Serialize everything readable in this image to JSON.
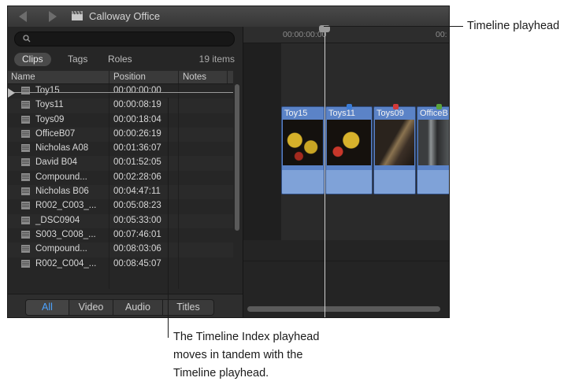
{
  "window": {
    "title": "Calloway Office"
  },
  "search": {
    "placeholder": ""
  },
  "tabs": [
    {
      "label": "Clips",
      "active": true
    },
    {
      "label": "Tags",
      "active": false
    },
    {
      "label": "Roles",
      "active": false
    }
  ],
  "items_count": "19 items",
  "columns": {
    "name": "Name",
    "position": "Position",
    "notes": "Notes"
  },
  "rows": [
    {
      "name": "Toy15",
      "position": "00:00:00:00"
    },
    {
      "name": "Toys11",
      "position": "00:00:08:19"
    },
    {
      "name": "Toys09",
      "position": "00:00:18:04"
    },
    {
      "name": "OfficeB07",
      "position": "00:00:26:19"
    },
    {
      "name": "Nicholas A08",
      "position": "00:01:36:07"
    },
    {
      "name": "David B04",
      "position": "00:01:52:05"
    },
    {
      "name": "Compound...",
      "position": "00:02:28:06"
    },
    {
      "name": "Nicholas B06",
      "position": "00:04:47:11"
    },
    {
      "name": "R002_C003_...",
      "position": "00:05:08:23"
    },
    {
      "name": "_DSC0904",
      "position": "00:05:33:00"
    },
    {
      "name": "S003_C008_...",
      "position": "00:07:46:01"
    },
    {
      "name": "Compound...",
      "position": "00:08:03:06"
    },
    {
      "name": "R002_C004_...",
      "position": "00:08:45:07"
    }
  ],
  "filters": [
    {
      "label": "All",
      "active": true
    },
    {
      "label": "Video",
      "active": false
    },
    {
      "label": "Audio",
      "active": false
    },
    {
      "label": "Titles",
      "active": false
    }
  ],
  "timeline": {
    "ruler": [
      "00:00:00:00",
      "00:"
    ],
    "clips": [
      {
        "label": "Toy15"
      },
      {
        "label": "Toys11"
      },
      {
        "label": "Toys09"
      },
      {
        "label": "OfficeB"
      }
    ],
    "marker_colors": [
      "#3a7bd5",
      "#d13a3a",
      "#5aa33a"
    ]
  },
  "callouts": {
    "timeline_playhead": "Timeline playhead",
    "index_playhead_lines": [
      "The Timeline Index playhead",
      "moves in tandem with the",
      "Timeline playhead."
    ]
  }
}
